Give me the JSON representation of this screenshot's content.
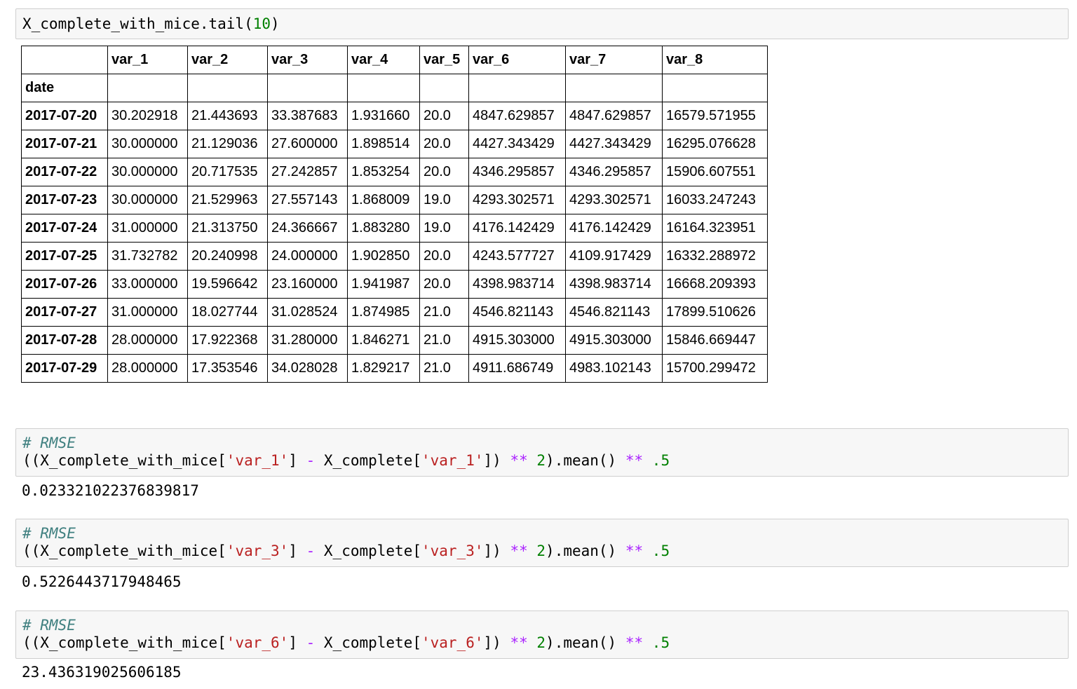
{
  "cell_1": {
    "code": {
      "prefix": "X_complete_with_mice.tail(",
      "arg": "10",
      "suffix": ")"
    }
  },
  "dataframe": {
    "index_name": "date",
    "columns": [
      "var_1",
      "var_2",
      "var_3",
      "var_4",
      "var_5",
      "var_6",
      "var_7",
      "var_8"
    ],
    "rows": [
      {
        "date": "2017-07-20",
        "values": [
          "30.202918",
          "21.443693",
          "33.387683",
          "1.931660",
          "20.0",
          "4847.629857",
          "4847.629857",
          "16579.571955"
        ]
      },
      {
        "date": "2017-07-21",
        "values": [
          "30.000000",
          "21.129036",
          "27.600000",
          "1.898514",
          "20.0",
          "4427.343429",
          "4427.343429",
          "16295.076628"
        ]
      },
      {
        "date": "2017-07-22",
        "values": [
          "30.000000",
          "20.717535",
          "27.242857",
          "1.853254",
          "20.0",
          "4346.295857",
          "4346.295857",
          "15906.607551"
        ]
      },
      {
        "date": "2017-07-23",
        "values": [
          "30.000000",
          "21.529963",
          "27.557143",
          "1.868009",
          "19.0",
          "4293.302571",
          "4293.302571",
          "16033.247243"
        ]
      },
      {
        "date": "2017-07-24",
        "values": [
          "31.000000",
          "21.313750",
          "24.366667",
          "1.883280",
          "19.0",
          "4176.142429",
          "4176.142429",
          "16164.323951"
        ]
      },
      {
        "date": "2017-07-25",
        "values": [
          "31.732782",
          "20.240998",
          "24.000000",
          "1.902850",
          "20.0",
          "4243.577727",
          "4109.917429",
          "16332.288972"
        ]
      },
      {
        "date": "2017-07-26",
        "values": [
          "33.000000",
          "19.596642",
          "23.160000",
          "1.941987",
          "20.0",
          "4398.983714",
          "4398.983714",
          "16668.209393"
        ]
      },
      {
        "date": "2017-07-27",
        "values": [
          "31.000000",
          "18.027744",
          "31.028524",
          "1.874985",
          "21.0",
          "4546.821143",
          "4546.821143",
          "17899.510626"
        ]
      },
      {
        "date": "2017-07-28",
        "values": [
          "28.000000",
          "17.922368",
          "31.280000",
          "1.846271",
          "21.0",
          "4915.303000",
          "4915.303000",
          "15846.669447"
        ]
      },
      {
        "date": "2017-07-29",
        "values": [
          "28.000000",
          "17.353546",
          "34.028028",
          "1.829217",
          "21.0",
          "4911.686749",
          "4983.102143",
          "15700.299472"
        ]
      }
    ]
  },
  "rmse_cells": [
    {
      "comment": "# RMSE",
      "code": {
        "open": "((X_complete_with_mice[",
        "key1": "'var_1'",
        "mid1": "] ",
        "minus": "-",
        "mid2": " X_complete[",
        "key2": "'var_1'",
        "mid3": "]) ",
        "pow1": "**",
        "sp1": " ",
        "two": "2",
        "mid4": ").mean() ",
        "pow2": "**",
        "sp2": " ",
        "half": ".5"
      },
      "output": "0.023321022376839817"
    },
    {
      "comment": "# RMSE",
      "code": {
        "open": "((X_complete_with_mice[",
        "key1": "'var_3'",
        "mid1": "] ",
        "minus": "-",
        "mid2": " X_complete[",
        "key2": "'var_3'",
        "mid3": "]) ",
        "pow1": "**",
        "sp1": " ",
        "two": "2",
        "mid4": ").mean() ",
        "pow2": "**",
        "sp2": " ",
        "half": ".5"
      },
      "output": "0.5226443717948465"
    },
    {
      "comment": "# RMSE",
      "code": {
        "open": "((X_complete_with_mice[",
        "key1": "'var_6'",
        "mid1": "] ",
        "minus": "-",
        "mid2": " X_complete[",
        "key2": "'var_6'",
        "mid3": "]) ",
        "pow1": "**",
        "sp1": " ",
        "two": "2",
        "mid4": ").mean() ",
        "pow2": "**",
        "sp2": " ",
        "half": ".5"
      },
      "output": "23.436319025606185"
    }
  ]
}
